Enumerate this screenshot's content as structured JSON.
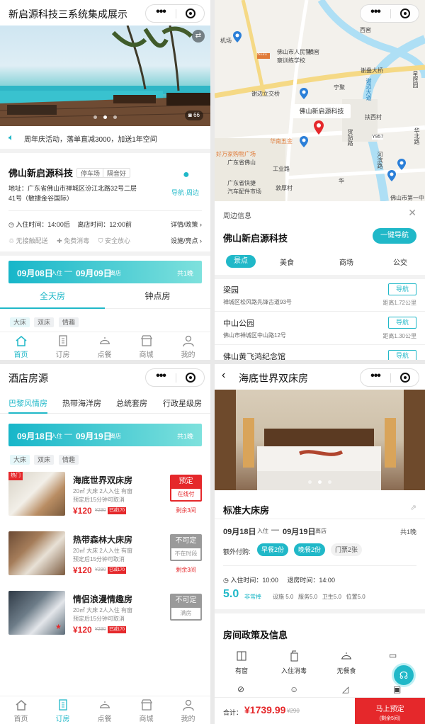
{
  "p1": {
    "title": "新启源科技三系统集成展示",
    "photo_count": "66",
    "notice": "周年庆活动，落单直减3000，加送1年空间",
    "hotel_name": "佛山新启源科技",
    "tags": [
      "停车场",
      "隔音好"
    ],
    "address": [
      "地址：广东省佛山市禅城区汾江北路32号二层",
      "41号（敏捷金谷国际）"
    ],
    "nav_label": "导航·周边",
    "checkin": "入住时间：14:00后",
    "checkout": "离店时间：12:00前",
    "policy_link": "详情/政策",
    "services": [
      "无接触配送",
      "免费消毒",
      "安全放心"
    ],
    "facility_link": "设施/亮点",
    "date_in": "09月08日",
    "date_out": "09月09日",
    "in_label": "入住",
    "out_label": "离店",
    "nights": "共1晚",
    "room_tabs": [
      "全天房",
      "钟点房"
    ],
    "filters": [
      "大床",
      "双床",
      "情趣"
    ],
    "tabbar": [
      "首页",
      "订房",
      "点餐",
      "商城",
      "我的"
    ]
  },
  "p2": {
    "map_labels": [
      "佛山市人民警",
      "察训练学校",
      "西窖",
      "横窖",
      "谢叠大桥",
      "机场",
      "谢边立交桥",
      "宁聚",
      "佛山新启源科技",
      "扶西村",
      "华南五金",
      "广东省佛山",
      "好万家购物广场",
      "华",
      "工业路",
      "敦厚村",
      "货站路",
      "广东省快捷",
      "汽车配件市场",
      "Y957",
      "S121",
      "河滨路",
      "华北路",
      "佛山市第一中学",
      "塘",
      "星辉园",
      "华北路",
      "华北路",
      "谢边大道"
    ],
    "callout": "佛山新启源科技",
    "sheet_title": "周边信息",
    "hotel": "佛山新启源科技",
    "nav_button": "一键导航",
    "categories": [
      "景点",
      "美食",
      "商场",
      "公交"
    ],
    "places": [
      {
        "name": "梁园",
        "addr": "禅城区松风路先锋古道93号",
        "dist": "距离1.72公里"
      },
      {
        "name": "中山公园",
        "addr": "佛山市禅城区中山路12号",
        "dist": "距离1.30公里"
      },
      {
        "name": "佛山黄飞鸿纪念馆",
        "addr": "",
        "dist": ""
      }
    ],
    "nav_btn": "导航"
  },
  "p3": {
    "title": "酒店房源",
    "tabs": [
      "巴黎风情房",
      "热带海洋房",
      "总统套房",
      "行政星级房"
    ],
    "date_in": "09月18日",
    "date_out": "09月19日",
    "in_label": "入住",
    "out_label": "离店",
    "nights": "共1晚",
    "filters": [
      "大床",
      "双床",
      "情趣"
    ],
    "rooms": [
      {
        "hot": "热门",
        "name": "海底世界双床房",
        "info1": "20㎡ 大床 2人入住 有窗",
        "info2": "预定后15分钟可取消",
        "price": "¥120",
        "orig": "¥290",
        "disc": "已减170",
        "btn1": "预定",
        "btn2": "在线付",
        "remain": "剩余3间"
      },
      {
        "name": "热带森林大床房",
        "info1": "20㎡ 大床 2人入住 有窗",
        "info2": "预定后15分钟可取消",
        "price": "¥120",
        "orig": "¥290",
        "disc": "已减170",
        "btn1": "不可定",
        "btn2": "不在时段",
        "remain": "剩余3间"
      },
      {
        "name": "情侣浪漫情趣房",
        "info1": "20㎡ 大床 2人入住 有窗",
        "info2": "预定后15分钟可取消",
        "price": "¥120",
        "orig": "¥290",
        "disc": "已减170",
        "btn1": "不可定",
        "btn2": "满房",
        "remain": ""
      }
    ],
    "tabbar": [
      "首页",
      "订房",
      "点餐",
      "商城",
      "我的"
    ]
  },
  "p4": {
    "title": "海底世界双床房",
    "room_type": "标准大床房",
    "date_in": "09月18日",
    "date_out": "09月19日",
    "in_label": "入住",
    "out_label": "离店",
    "nights": "共1晚",
    "extra_label": "额外付购:",
    "extras": [
      "早餐2份",
      "晚餐2份",
      "门票2张"
    ],
    "checkin": "入住时间：10:00",
    "checkout": "退房时间：14:00",
    "score": "5.0",
    "score_word": "非常棒",
    "scores": [
      "设施 5.0",
      "服务5.0",
      "卫生5.0",
      "位置5.0"
    ],
    "policy_title": "房间政策及信息",
    "amenities": [
      "有窗",
      "入住消毒",
      "无餐食"
    ],
    "total_label": "合计：",
    "total": "¥1739.99",
    "total_orig": "¥290",
    "book": "马上预定",
    "remain": "(剩余5间)"
  },
  "colors": {
    "accent": "#20b8c8",
    "price": "#e5282b",
    "disabled": "#9a9a9a"
  }
}
